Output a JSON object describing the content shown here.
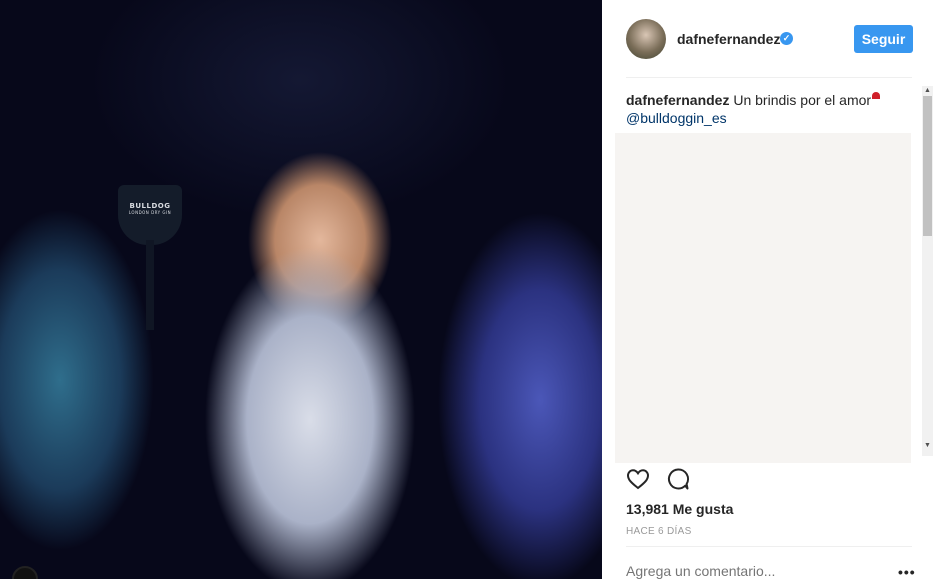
{
  "post": {
    "image_alt": "",
    "glass_logo": "BULLDOG",
    "glass_sublabel": "LONDON DRY GIN"
  },
  "header": {
    "username": "dafnefernandez",
    "verified_icon": "verified-badge-icon",
    "follow_label": "Seguir"
  },
  "caption": {
    "username": "dafnefernandez",
    "text": "Un brindis por el amor",
    "emoji": "heart-icon",
    "mention": "@bulldoggin_es"
  },
  "actions": {
    "like_icon": "heart-outline-icon",
    "comment_icon": "comment-bubble-icon"
  },
  "stats": {
    "likes": "13,981 Me gusta",
    "time": "HACE 6 DÍAS"
  },
  "comment_box": {
    "placeholder": "Agrega un comentario...",
    "more_label": "•••"
  },
  "colors": {
    "accent": "#3897f0",
    "text": "#262626",
    "muted": "#999999"
  }
}
